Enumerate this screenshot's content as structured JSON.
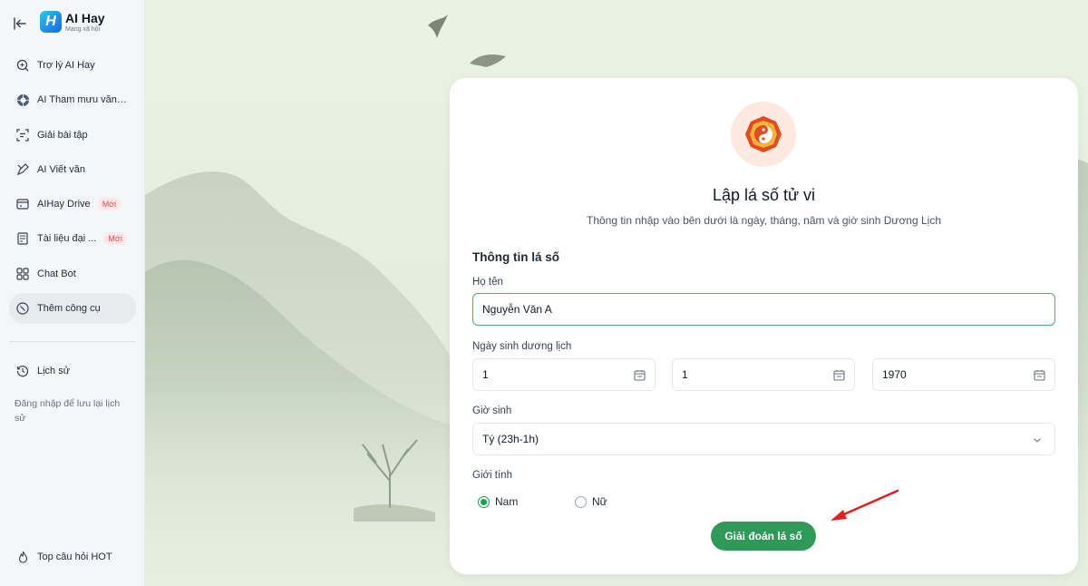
{
  "app": {
    "name": "AI Hay",
    "tagline": "Mạng xã hội",
    "logo_letter": "H"
  },
  "sidebar": {
    "items": [
      {
        "label": "Trợ lý AI Hay",
        "icon": "search-sparkle-icon"
      },
      {
        "label": "AI Tham mưu văn ...",
        "icon": "globe-icon"
      },
      {
        "label": "Giải bài tập",
        "icon": "scan-icon"
      },
      {
        "label": "AI Viết văn",
        "icon": "pen-icon"
      },
      {
        "label": "AIHay Drive",
        "icon": "drive-icon",
        "badge": "Mới"
      },
      {
        "label": "Tài liệu đại ...",
        "icon": "book-icon",
        "badge": "Mới"
      },
      {
        "label": "Chat Bot",
        "icon": "grid-icon"
      },
      {
        "label": "Thêm công cụ",
        "icon": "compass-icon",
        "active": true
      }
    ],
    "history_label": "Lịch sử",
    "history_note": "Đăng nhập để lưu lại lịch sử",
    "hot_label": "Top câu hỏi HOT"
  },
  "card": {
    "title": "Lập lá số tử vi",
    "subtitle": "Thông tin nhập vào bên dưới là ngày, tháng, năm và giờ sinh Dương Lịch",
    "section_title": "Thông tin lá số",
    "name_label": "Họ tên",
    "name_value": "Nguyễn Văn A",
    "dob_label": "Ngày sinh dương lịch",
    "day": "1",
    "month": "1",
    "year": "1970",
    "hour_label": "Giờ sinh",
    "hour_value": "Tý (23h-1h)",
    "gender_label": "Giới tính",
    "gender_options": [
      "Nam",
      "Nữ"
    ],
    "gender_selected": "Nam",
    "submit_label": "Giải đoán lá số"
  },
  "colors": {
    "accent": "#2f9a58",
    "badge": "#e5484d",
    "arrow": "#e02020",
    "background": "#e4eedd"
  }
}
